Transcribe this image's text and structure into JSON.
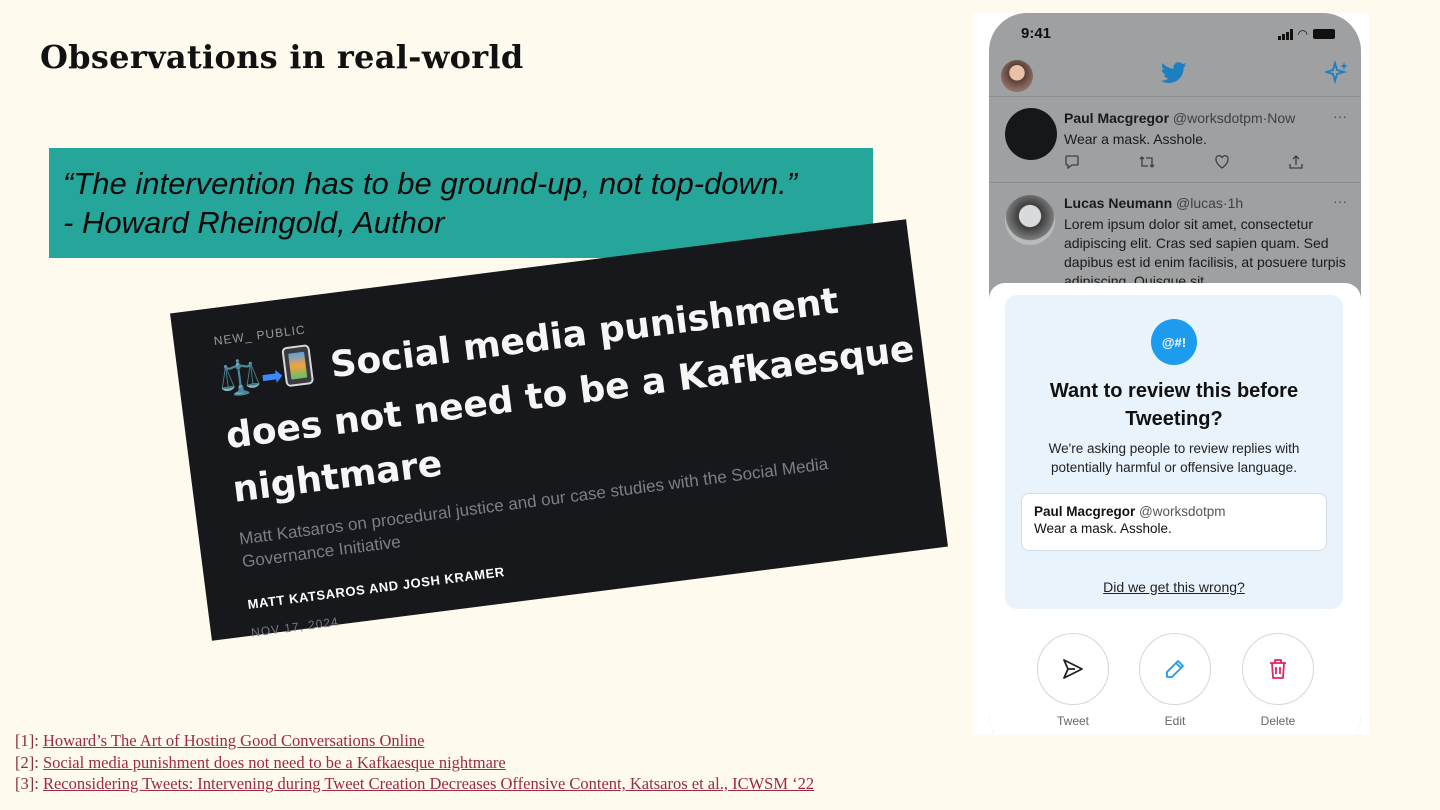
{
  "slide": {
    "title": "Observations in real-world"
  },
  "quote": {
    "line1": "“The intervention has to be ground-up, not top-down.”",
    "line2": "- Howard Rheingold, Author"
  },
  "article": {
    "brand": "NEW_ PUBLIC",
    "emoji": "⚖️",
    "arrow": "➡",
    "headline": "Social media punishment does not need to be a Kafkaesque nightmare",
    "subtitle": "Matt Katsaros on procedural justice and our case studies with the Social Media Governance Initiative",
    "authors": "MATT KATSAROS AND JOSH KRAMER",
    "date": "NOV 17, 2024"
  },
  "phone": {
    "status_time": "9:41",
    "header_icons": [
      "profile-avatar",
      "twitter-bird-icon",
      "sparkle-icon"
    ],
    "tweets": [
      {
        "name": "Paul Macgregor",
        "handle": "@worksdotpm",
        "time": "·Now",
        "text": "Wear a mask. Asshole.",
        "more": "···"
      },
      {
        "name": "Lucas Neumann",
        "handle": "@lucas",
        "time": "·1h",
        "text": "Lorem ipsum dolor sit amet, consectetur adipiscing elit. Cras sed sapien quam. Sed dapibus est id enim facilisis, at posuere turpis adipiscing. Quisque sit",
        "more": "···"
      }
    ],
    "tweet_action_icons": [
      "reply-icon",
      "retweet-icon",
      "like-icon",
      "share-icon"
    ],
    "prompt": {
      "badge": "@#!",
      "title": "Want to review this before Tweeting?",
      "description": "We're asking people to review replies with potentially harmful or offensive language.",
      "preview_name": "Paul Macgregor",
      "preview_handle": "@worksdotpm",
      "preview_text": "Wear a mask. Asshole.",
      "link": "Did we get this wrong?"
    },
    "actions": [
      {
        "label": "Tweet",
        "icon": "send-icon"
      },
      {
        "label": "Edit",
        "icon": "pencil-icon"
      },
      {
        "label": "Delete",
        "icon": "trash-icon"
      }
    ]
  },
  "references": [
    {
      "num": "[1]: ",
      "text": "Howard’s The Art of Hosting Good Conversations Online"
    },
    {
      "num": "[2]: ",
      "text": "Social media punishment does not need to be a Kafkaesque nightmare"
    },
    {
      "num": "[3]: ",
      "text": "Reconsidering Tweets: Intervening during Tweet Creation Decreases Offensive Content, Katsaros et al., ICWSM ‘22"
    }
  ],
  "colors": {
    "background": "#fffaee",
    "quote_box": "#26a69a",
    "article_bg": "#17181b",
    "twitter_blue": "#1c9bef",
    "prompt_bg": "#e9f3fc",
    "delete_pink": "#e0245e",
    "reference_link": "#9c2a42"
  }
}
